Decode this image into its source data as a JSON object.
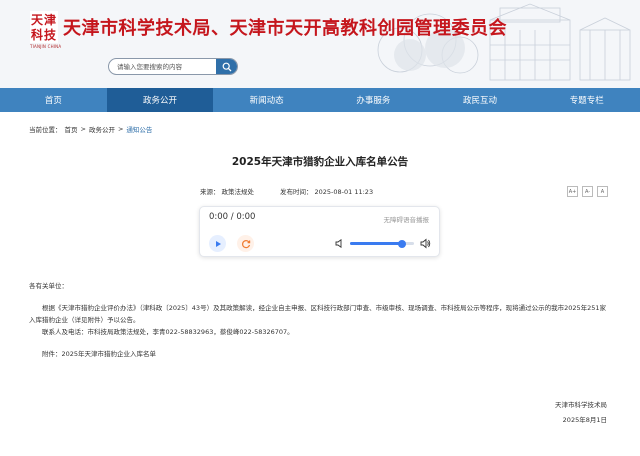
{
  "header": {
    "logo_text": "天津科技",
    "logo_sub": "TIANJIN CHINA",
    "site_title": "天津市科学技术局、天津市天开高教科创园管理委员会",
    "search_placeholder": "请输入您要搜索的内容",
    "icons": {
      "search": "search-icon"
    }
  },
  "nav": {
    "items": [
      {
        "label": "首页"
      },
      {
        "label": "政务公开"
      },
      {
        "label": "新闻动态"
      },
      {
        "label": "办事服务"
      },
      {
        "label": "政民互动"
      },
      {
        "label": "专题专栏"
      }
    ],
    "active_index": 1
  },
  "breadcrumb": {
    "prefix": "当前位置：",
    "items": [
      "首页",
      "政务公开",
      "通知公告"
    ],
    "separator": ">"
  },
  "article": {
    "title": "2025年天津市猎豹企业入库名单公告",
    "source_label": "来源：",
    "source": "政策法规处",
    "date_label": "发布时间：",
    "date": "2025-08-01 11:23",
    "font_tools": [
      "A+",
      "A-",
      "A"
    ]
  },
  "player": {
    "time": "0:00 / 0:00",
    "label": "无障碍语音播报",
    "volume": 0.82
  },
  "body": {
    "salutation": "各有关单位：",
    "para1": "根据《天津市猎豹企业评价办法》（津科政〔2025〕43号）及其政策解读，经企业自主申报、区科技行政部门审查、市级审核、现场调查、市科技局公示等程序，现将通过公示的我市2025年251家入库猎豹企业（详见附件）予以公告。",
    "contact": "联系人及电话：市科技局政策法规处，李青022-58832963，蔡俊峰022-58326707。",
    "attachment": "附件：2025年天津市猎豹企业入库名单"
  },
  "signature": {
    "org": "天津市科学技术局",
    "date": "2025年8月1日"
  },
  "colors": {
    "nav": "#3f83bf",
    "nav_active": "#1f5d97",
    "title_red": "#c5161d",
    "accent_blue": "#3a7bf0"
  }
}
